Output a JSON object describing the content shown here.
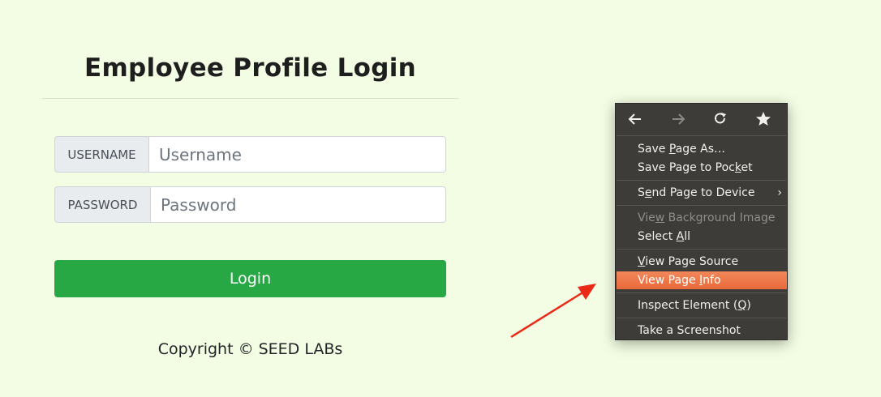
{
  "page": {
    "title": "Employee Profile Login",
    "username": {
      "label": "USERNAME",
      "placeholder": "Username"
    },
    "password": {
      "label": "PASSWORD",
      "placeholder": "Password"
    },
    "login_button": "Login",
    "copyright": "Copyright © SEED LABs"
  },
  "colors": {
    "background": "#f3fde3",
    "login_button": "#28a745",
    "menu_bg": "#3d3c38",
    "menu_highlight": "#ec7444",
    "arrow": "#ea2a17"
  },
  "context_menu": {
    "nav": [
      "back-icon",
      "forward-icon",
      "reload-icon",
      "bookmark-star-icon"
    ],
    "items": [
      {
        "pre": "Save ",
        "key": "P",
        "post": "age As…"
      },
      {
        "pre": "Save Page to Poc",
        "key": "k",
        "post": "et"
      },
      {
        "pre": "S",
        "key": "e",
        "post": "nd Page to Device"
      },
      {
        "pre": "Vie",
        "key": "w",
        "post": " Background Image"
      },
      {
        "pre": "Select ",
        "key": "A",
        "post": "ll"
      },
      {
        "pre": "",
        "key": "V",
        "post": "iew Page Source"
      },
      {
        "pre": "View Page ",
        "key": "I",
        "post": "nfo"
      },
      {
        "pre": "Inspect Element (",
        "key": "Q",
        "post": ")"
      },
      {
        "pre": "Take a Screenshot",
        "key": "",
        "post": ""
      }
    ]
  }
}
